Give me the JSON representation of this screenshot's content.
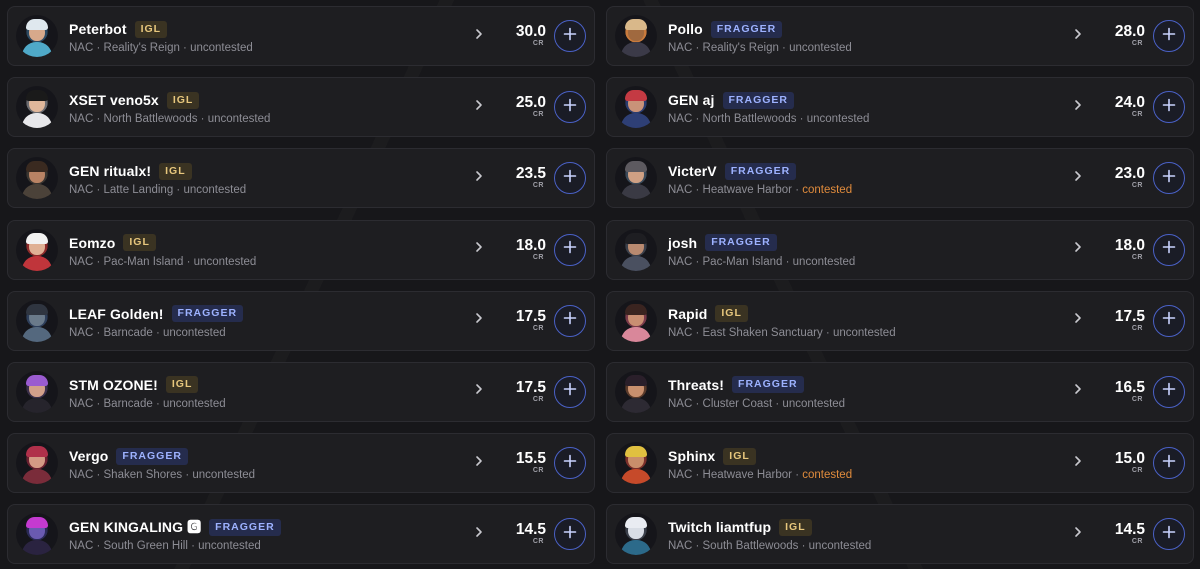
{
  "unit_label": "CR",
  "players": [
    {
      "name": "Peterbot",
      "role": "IGL",
      "region": "NAC",
      "location": "Reality's Reign",
      "status": "uncontested",
      "credits": "30.0",
      "colors": {
        "bg": "#2c4a63",
        "skin": "#d7a98b",
        "hair": "#dfe8ee",
        "outfit": "#4fa9c8"
      }
    },
    {
      "name": "Pollo",
      "role": "FRAGGER",
      "region": "NAC",
      "location": "Reality's Reign",
      "status": "uncontested",
      "credits": "28.0",
      "colors": {
        "bg": "#c97a3c",
        "skin": "#a0693f",
        "hair": "#d9b88a",
        "outfit": "#3b3a48"
      }
    },
    {
      "name": "XSET veno5x",
      "role": "IGL",
      "region": "NAC",
      "location": "North Battlewoods",
      "status": "uncontested",
      "credits": "25.0",
      "colors": {
        "bg": "#6b6b70",
        "skin": "#e0b79b",
        "hair": "#1a1a1a",
        "outfit": "#e7e7ea"
      }
    },
    {
      "name": "GEN aj",
      "role": "FRAGGER",
      "region": "NAC",
      "location": "North Battlewoods",
      "status": "uncontested",
      "credits": "24.0",
      "colors": {
        "bg": "#2a3c6e",
        "skin": "#c99279",
        "hair": "#c43a43",
        "outfit": "#2e3f75"
      }
    },
    {
      "name": "GEN ritualx!",
      "role": "IGL",
      "region": "NAC",
      "location": "Latte Landing",
      "status": "uncontested",
      "credits": "23.5",
      "colors": {
        "bg": "#3a3631",
        "skin": "#b98364",
        "hair": "#3a2a20",
        "outfit": "#4b4239"
      }
    },
    {
      "name": "VicterV",
      "role": "FRAGGER",
      "region": "NAC",
      "location": "Heatwave Harbor",
      "status": "contested",
      "credits": "23.0",
      "colors": {
        "bg": "#3a4a5a",
        "skin": "#cfa084",
        "hair": "#5d5a60",
        "outfit": "#3a3a44"
      }
    },
    {
      "name": "Eomzo",
      "role": "IGL",
      "region": "NAC",
      "location": "Pac-Man Island",
      "status": "uncontested",
      "credits": "18.0",
      "colors": {
        "bg": "#8d2a2a",
        "skin": "#e0b195",
        "hair": "#f2f2f2",
        "outfit": "#c0353b"
      }
    },
    {
      "name": "josh",
      "role": "FRAGGER",
      "region": "NAC",
      "location": "Pac-Man Island",
      "status": "uncontested",
      "credits": "18.0",
      "colors": {
        "bg": "#3a3f4a",
        "skin": "#b98a70",
        "hair": "#1e1e22",
        "outfit": "#4a5060"
      }
    },
    {
      "name": "LEAF Golden!",
      "role": "FRAGGER",
      "region": "NAC",
      "location": "Barncade",
      "status": "uncontested",
      "credits": "17.5",
      "colors": {
        "bg": "#2d3e5a",
        "skin": "#6a7a8a",
        "hair": "#2f3540",
        "outfit": "#54687e"
      }
    },
    {
      "name": "Rapid",
      "role": "IGL",
      "region": "NAC",
      "location": "East Shaken Sanctuary",
      "status": "uncontested",
      "credits": "17.5",
      "colors": {
        "bg": "#7a3a4a",
        "skin": "#c98e72",
        "hair": "#3a2420",
        "outfit": "#d9879a"
      }
    },
    {
      "name": "STM OZONE!",
      "role": "IGL",
      "region": "NAC",
      "location": "Barncade",
      "status": "uncontested",
      "credits": "17.5",
      "colors": {
        "bg": "#3a2f4a",
        "skin": "#d2a08a",
        "hair": "#9a5bd0",
        "outfit": "#26242c"
      }
    },
    {
      "name": "Threats!",
      "role": "FRAGGER",
      "region": "NAC",
      "location": "Cluster Coast",
      "status": "uncontested",
      "credits": "16.5",
      "colors": {
        "bg": "#5a3a2a",
        "skin": "#c9906e",
        "hair": "#2a1f2a",
        "outfit": "#2d2a33"
      }
    },
    {
      "name": "Vergo",
      "role": "FRAGGER",
      "region": "NAC",
      "location": "Shaken Shores",
      "status": "uncontested",
      "credits": "15.5",
      "colors": {
        "bg": "#6a2030",
        "skin": "#d49a85",
        "hair": "#b0304a",
        "outfit": "#7a2c3a"
      }
    },
    {
      "name": "Sphinx",
      "role": "IGL",
      "region": "NAC",
      "location": "Heatwave Harbor",
      "status": "contested",
      "credits": "15.0",
      "colors": {
        "bg": "#7a2f2a",
        "skin": "#c98f6b",
        "hair": "#e0c040",
        "outfit": "#c64a2a"
      }
    },
    {
      "name": "GEN KINGALING 🅶",
      "role": "FRAGGER",
      "region": "NAC",
      "location": "South Green Hill",
      "status": "uncontested",
      "credits": "14.5",
      "colors": {
        "bg": "#2a2a55",
        "skin": "#6a5ab0",
        "hair": "#c43ad0",
        "outfit": "#2a2340"
      }
    },
    {
      "name": "Twitch liamtfup",
      "role": "IGL",
      "region": "NAC",
      "location": "South Battlewoods",
      "status": "uncontested",
      "credits": "14.5",
      "colors": {
        "bg": "#3a3f4a",
        "skin": "#d8dde5",
        "hair": "#e9ecf2",
        "outfit": "#2c6a8a"
      }
    }
  ]
}
